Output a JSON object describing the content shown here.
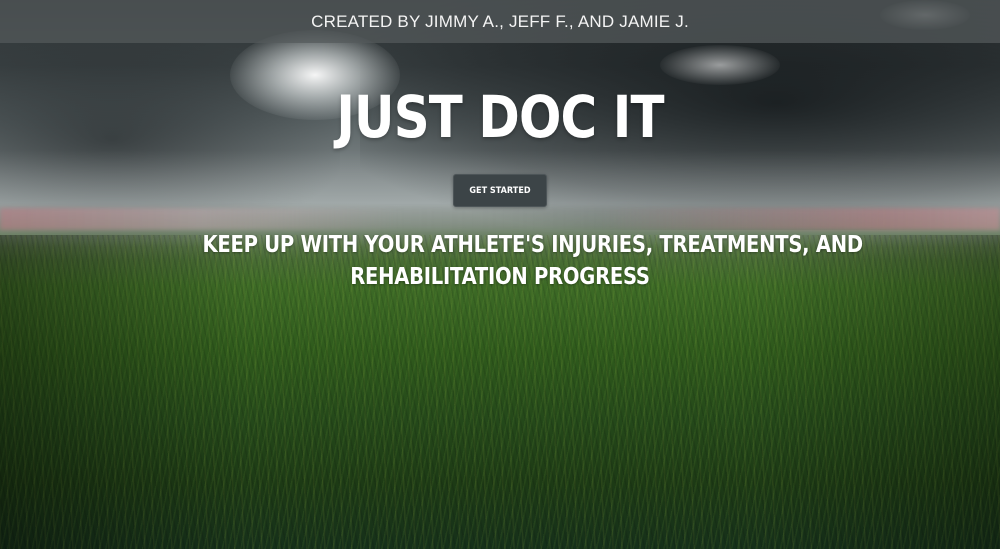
{
  "header": {
    "credits": "CREATED BY JIMMY A., JEFF F., AND JAMIE J."
  },
  "hero": {
    "title": "JUST DOC IT",
    "cta_label": "GET STARTED",
    "tagline_line1": "KEEP UP WITH YOUR ATHLETE'S INJURIES, TREATMENTS, AND",
    "tagline_line2": "REHABILITATION PROGRESS"
  },
  "colors": {
    "text": "#ffffff",
    "banner_bg": "#555a5c",
    "button_bg": "#3c4447",
    "grass": "#2f5a1c"
  }
}
